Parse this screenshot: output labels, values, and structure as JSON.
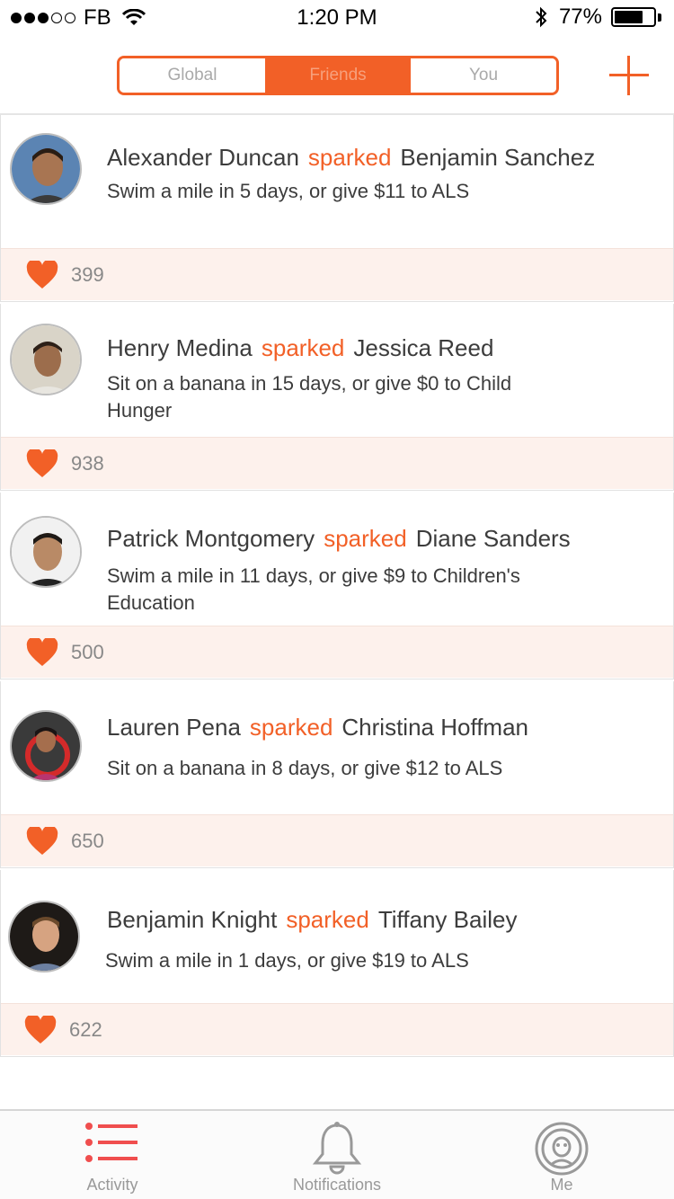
{
  "status_bar": {
    "carrier": "FB",
    "time": "1:20 PM",
    "battery": "77%",
    "battery_level": 0.77,
    "signal_bars_filled": 3,
    "signal_bars_total": 5
  },
  "segmented": {
    "tabs": [
      {
        "label": "Global"
      },
      {
        "label": "Friends"
      },
      {
        "label": "You"
      }
    ],
    "active": "Friends"
  },
  "feed": [
    {
      "actor": "Alexander Duncan",
      "verb": "sparked",
      "target": "Benjamin Sanchez",
      "challenge": "Swim a mile in 5 days, or give $11 to ALS",
      "likes": "399"
    },
    {
      "actor": "Henry Medina",
      "verb": "sparked",
      "target": "Jessica Reed",
      "challenge": "Sit on a banana in 15 days, or give $0 to Child Hunger",
      "likes": "938"
    },
    {
      "actor": "Patrick Montgomery",
      "verb": "sparked",
      "target": "Diane Sanders",
      "challenge": "Swim a mile in 11 days, or give $9 to Children's Education",
      "likes": "500"
    },
    {
      "actor": "Lauren Pena",
      "verb": "sparked",
      "target": "Christina Hoffman",
      "challenge": "Sit on a banana in 8 days, or give $12 to ALS",
      "likes": "650"
    },
    {
      "actor": "Benjamin Knight",
      "verb": "sparked",
      "target": "Tiffany Bailey",
      "challenge": "Swim a mile in 1 days, or give $19 to ALS",
      "likes": "622"
    }
  ],
  "tab_bar": {
    "tabs": [
      {
        "label": "Activity",
        "icon": "list-icon",
        "active": true
      },
      {
        "label": "Notifications",
        "icon": "bell-icon",
        "active": false
      },
      {
        "label": "Me",
        "icon": "profile-icon",
        "active": false
      }
    ]
  },
  "colors": {
    "accent": "#f26027",
    "likes_background": "#fdf1ec",
    "inactive_text": "#999999"
  }
}
